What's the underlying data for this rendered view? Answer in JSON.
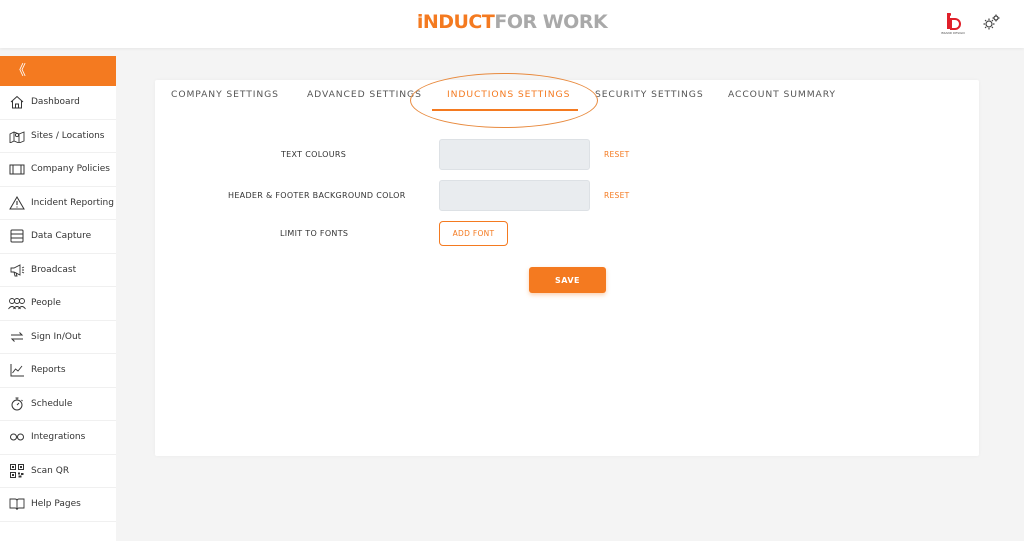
{
  "header": {
    "logo_part1": "iNDUCT",
    "logo_part2": "FOR WORK",
    "brand_badge_caption": "BRAND DESIGN",
    "settings_icon": "gear-icon"
  },
  "colors": {
    "accent": "#f47a20",
    "logo_grey": "#a9a9a9",
    "input_bg": "#e9ecef"
  },
  "sidebar": {
    "collapse_label": "《",
    "items": [
      {
        "label": "Dashboard",
        "icon": "home-icon"
      },
      {
        "label": "Sites / Locations",
        "icon": "sites-icon"
      },
      {
        "label": "Company Policies",
        "icon": "film-icon"
      },
      {
        "label": "Incident Reporting",
        "icon": "warning-icon"
      },
      {
        "label": "Data Capture",
        "icon": "form-icon"
      },
      {
        "label": "Broadcast",
        "icon": "megaphone-icon"
      },
      {
        "label": "People",
        "icon": "people-icon"
      },
      {
        "label": "Sign In/Out",
        "icon": "swap-icon"
      },
      {
        "label": "Reports",
        "icon": "chart-icon"
      },
      {
        "label": "Schedule",
        "icon": "stopwatch-icon"
      },
      {
        "label": "Integrations",
        "icon": "link-icon"
      },
      {
        "label": "Scan QR",
        "icon": "qr-icon"
      },
      {
        "label": "Help Pages",
        "icon": "book-icon"
      }
    ]
  },
  "tabs": [
    {
      "label": "COMPANY SETTINGS"
    },
    {
      "label": "ADVANCED SETTINGS"
    },
    {
      "label": "INDUCTIONS SETTINGS",
      "active": true
    },
    {
      "label": "SECURITY SETTINGS"
    },
    {
      "label": "ACCOUNT SUMMARY"
    }
  ],
  "form": {
    "text_colours_label": "TEXT COLOURS",
    "text_colours_value": "",
    "header_footer_label": "HEADER & FOOTER BACKGROUND COLOR",
    "header_footer_value": "",
    "reset_label": "RESET",
    "limit_fonts_label": "LIMIT TO FONTS",
    "add_font_label": "ADD FONT",
    "save_label": "SAVE"
  }
}
